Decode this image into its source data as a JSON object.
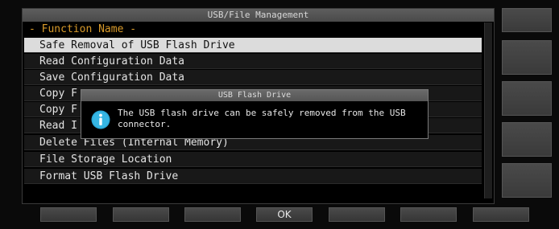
{
  "window": {
    "title": "USB/File Management"
  },
  "list": {
    "header": "- Function Name -",
    "items": [
      "Safe Removal of USB Flash Drive",
      "Read Configuration Data",
      "Save Configuration Data",
      "Copy F",
      "Copy F",
      "Read I",
      "Delete Files (Internal Memory)",
      "File Storage Location",
      "Format USB Flash Drive"
    ],
    "selected_index": 0
  },
  "dialog": {
    "title": "USB Flash Drive",
    "icon": "info-icon",
    "message_line1": "The USB flash drive can be safely removed from the USB",
    "message_line2": "connector."
  },
  "softkeys": [
    "",
    "",
    "",
    "OK",
    "",
    "",
    ""
  ],
  "colors": {
    "header": "#d89a2a",
    "selected_row": "#dcdcdc",
    "info_icon": "#2aa8d8"
  }
}
